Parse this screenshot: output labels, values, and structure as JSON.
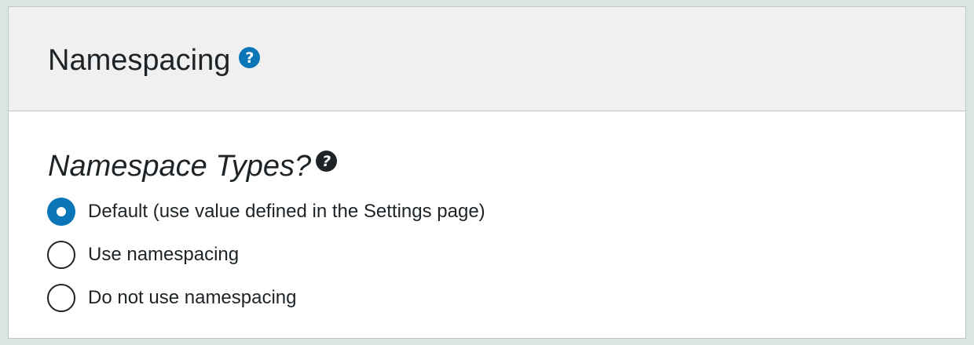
{
  "panel": {
    "title": "Namespacing",
    "title_help_glyph": "?",
    "section_heading": "Namespace Types?",
    "section_help_glyph": "?",
    "options": [
      {
        "label": "Default (use value defined in the Settings page)",
        "checked": true
      },
      {
        "label": "Use namespacing",
        "checked": false
      },
      {
        "label": "Do not use namespacing",
        "checked": false
      }
    ]
  },
  "colors": {
    "accent": "#0a76b8",
    "header_bg": "#f0f0f0",
    "page_bg": "#d9e6e1",
    "text": "#1d2327"
  },
  "icons": {
    "title_help": "question-circle-icon",
    "section_help": "question-circle-icon"
  }
}
